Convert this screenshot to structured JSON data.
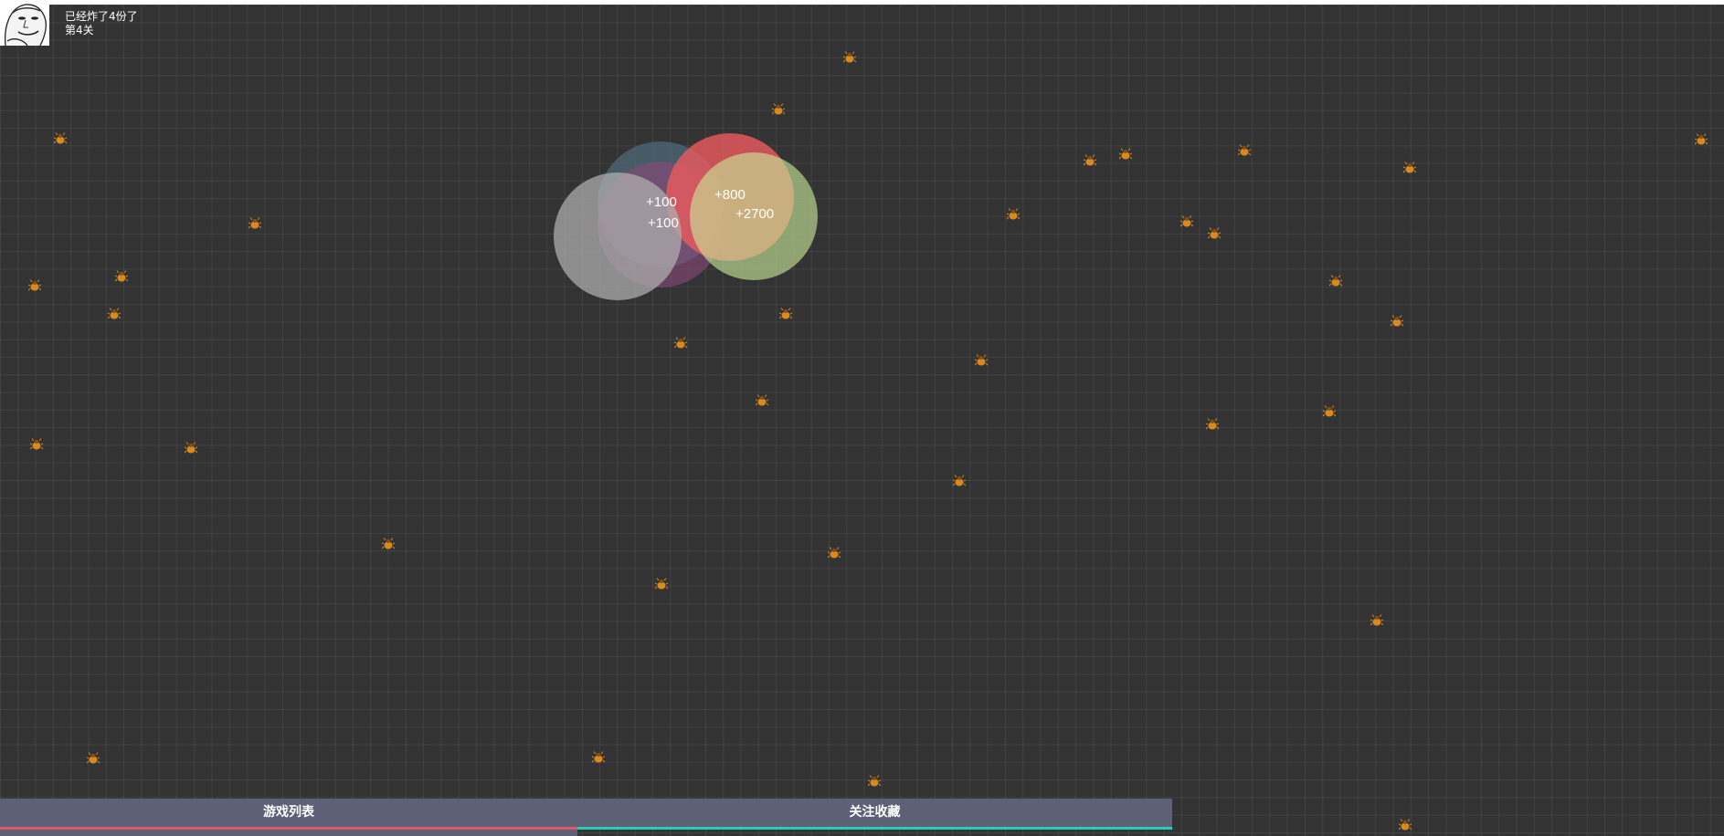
{
  "hud": {
    "exploded_text": "已经炸了4份了",
    "level_text": "第4关"
  },
  "scores": [
    "+100",
    "+100",
    "+800",
    "+2700"
  ],
  "tabs": {
    "games_label": "游戏列表",
    "follow_label": "关注收藏"
  },
  "colors": {
    "background": "#333333",
    "bug": "#d98a1e",
    "tab_bg": "#5d6076",
    "tab_games_accent": "#e0576a",
    "tab_follow_accent": "#27d0b5"
  },
  "icons": {
    "bug": "bug-icon",
    "avatar": "meme-face-avatar"
  }
}
